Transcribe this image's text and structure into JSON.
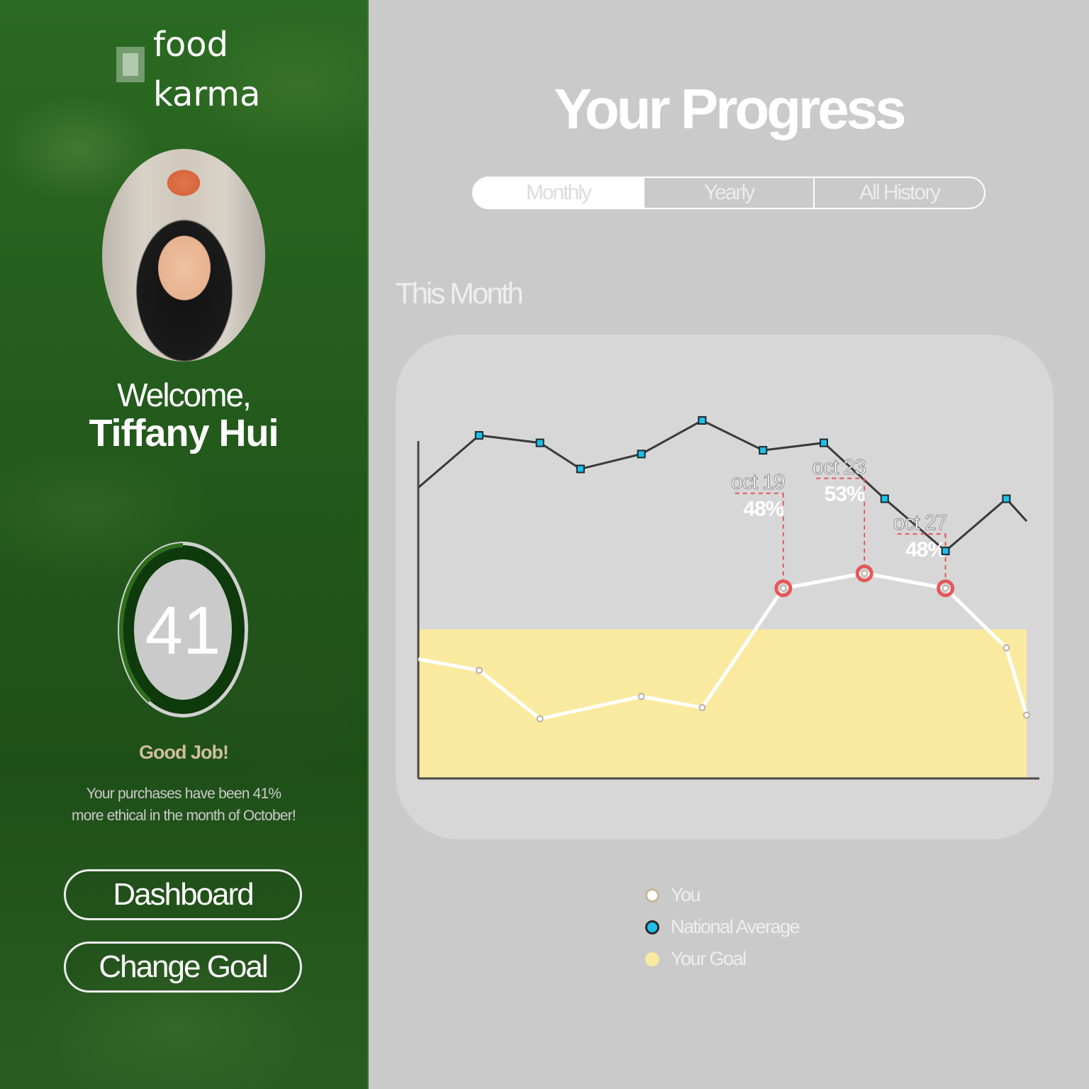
{
  "app": {
    "logo_line1": "food",
    "logo_line2": "karma"
  },
  "sidebar": {
    "welcome": "Welcome,",
    "user_name": "Tiffany Hui",
    "score": "41",
    "score_fraction": 0.41,
    "headline": "Good Job!",
    "summary": "Your purchases have been 41% more ethical in the month of October!",
    "nav": [
      {
        "label": "Dashboard"
      },
      {
        "label": "Change Goal"
      }
    ]
  },
  "main": {
    "title": "Your Progress",
    "tabs": [
      {
        "label": "Monthly",
        "active": true
      },
      {
        "label": "Yearly",
        "active": false
      },
      {
        "label": "All History",
        "active": false
      }
    ],
    "section_label": "This Month"
  },
  "legend": [
    {
      "label": "You",
      "color": "#c8b79b"
    },
    {
      "label": "National Average",
      "color": "#1fc0e6"
    },
    {
      "label": "Your Goal",
      "color": "#f9ea9f"
    }
  ],
  "colors": {
    "sidebar_green": "#235a1c",
    "national_line": "#3a3a3a",
    "national_marker": "#1fc0e6",
    "you_line": "#ffffff",
    "highlight": "#e5585a",
    "goal_band": "#f9ea9f"
  },
  "chart_data": {
    "type": "line",
    "title": "This Month",
    "xlabel": "",
    "ylabel": "",
    "grid": false,
    "goal_band": [
      0,
      40
    ],
    "ylim": [
      0,
      100
    ],
    "xlim": [
      1,
      31
    ],
    "series": [
      {
        "name": "National Average",
        "x": [
          1,
          4,
          7,
          9,
          12,
          15,
          18,
          21,
          24,
          27,
          30,
          31
        ],
        "y": [
          78,
          92,
          90,
          83,
          87,
          96,
          88,
          90,
          75,
          61,
          75,
          69
        ]
      },
      {
        "name": "You",
        "x": [
          1,
          4,
          7,
          12,
          15,
          19,
          23,
          27,
          30,
          31
        ],
        "y": [
          32,
          29,
          16,
          22,
          19,
          51,
          55,
          51,
          35,
          17
        ]
      }
    ],
    "annotations": [
      {
        "date": "oct 19",
        "value": "48%",
        "x": 19
      },
      {
        "date": "oct 23",
        "value": "53%",
        "x": 23
      },
      {
        "date": "oct 27",
        "value": "48%",
        "x": 27
      }
    ]
  }
}
